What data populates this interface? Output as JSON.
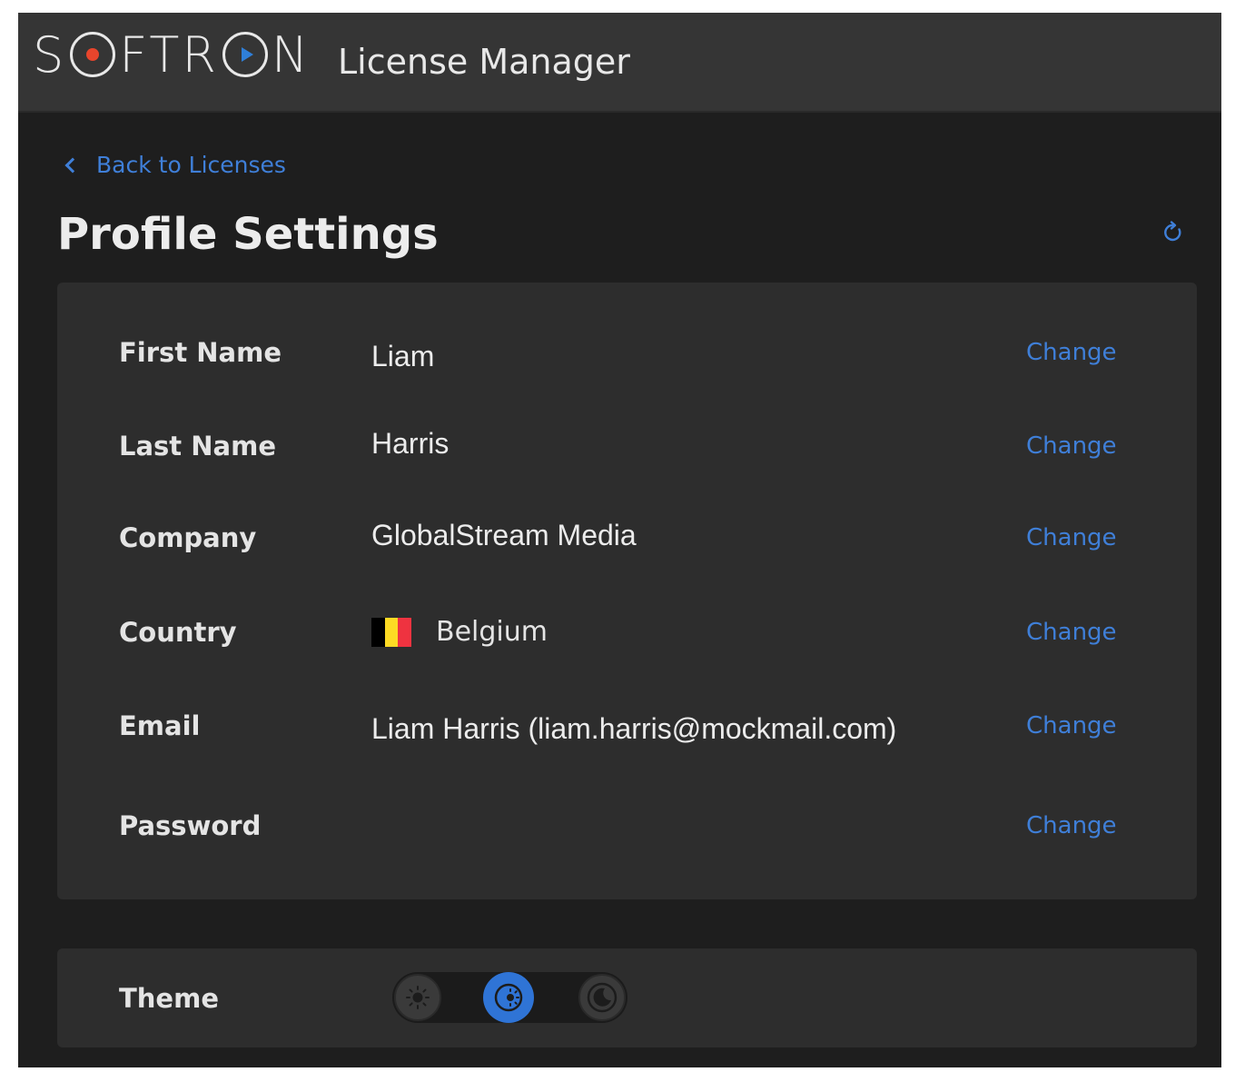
{
  "header": {
    "logo_text_left": "S",
    "logo_text_mid": "FTR",
    "logo_text_right": "N",
    "app_title": "License Manager"
  },
  "nav": {
    "back_label": "Back to Licenses"
  },
  "page": {
    "title": "Profile Settings"
  },
  "profile": {
    "change_label": "Change",
    "first_name": {
      "label": "First Name",
      "value": "Liam"
    },
    "last_name": {
      "label": "Last Name",
      "value": "Harris"
    },
    "company": {
      "label": "Company",
      "value": "GlobalStream Media"
    },
    "country": {
      "label": "Country",
      "value": "Belgium",
      "flag_colors": [
        "#000000",
        "#fdda24",
        "#ef3340"
      ]
    },
    "email": {
      "label": "Email",
      "value": "Liam Harris (liam.harris@mockmail.com)"
    },
    "password": {
      "label": "Password",
      "value": ""
    }
  },
  "theme": {
    "label": "Theme",
    "options": [
      "light",
      "auto",
      "dark"
    ],
    "selected": "auto"
  },
  "colors": {
    "accent": "#3f7fd8",
    "logo_record": "#e8452c",
    "logo_play": "#2f7fd8",
    "background": "#1e1e1e",
    "card": "#2d2d2d",
    "header": "#353535"
  }
}
